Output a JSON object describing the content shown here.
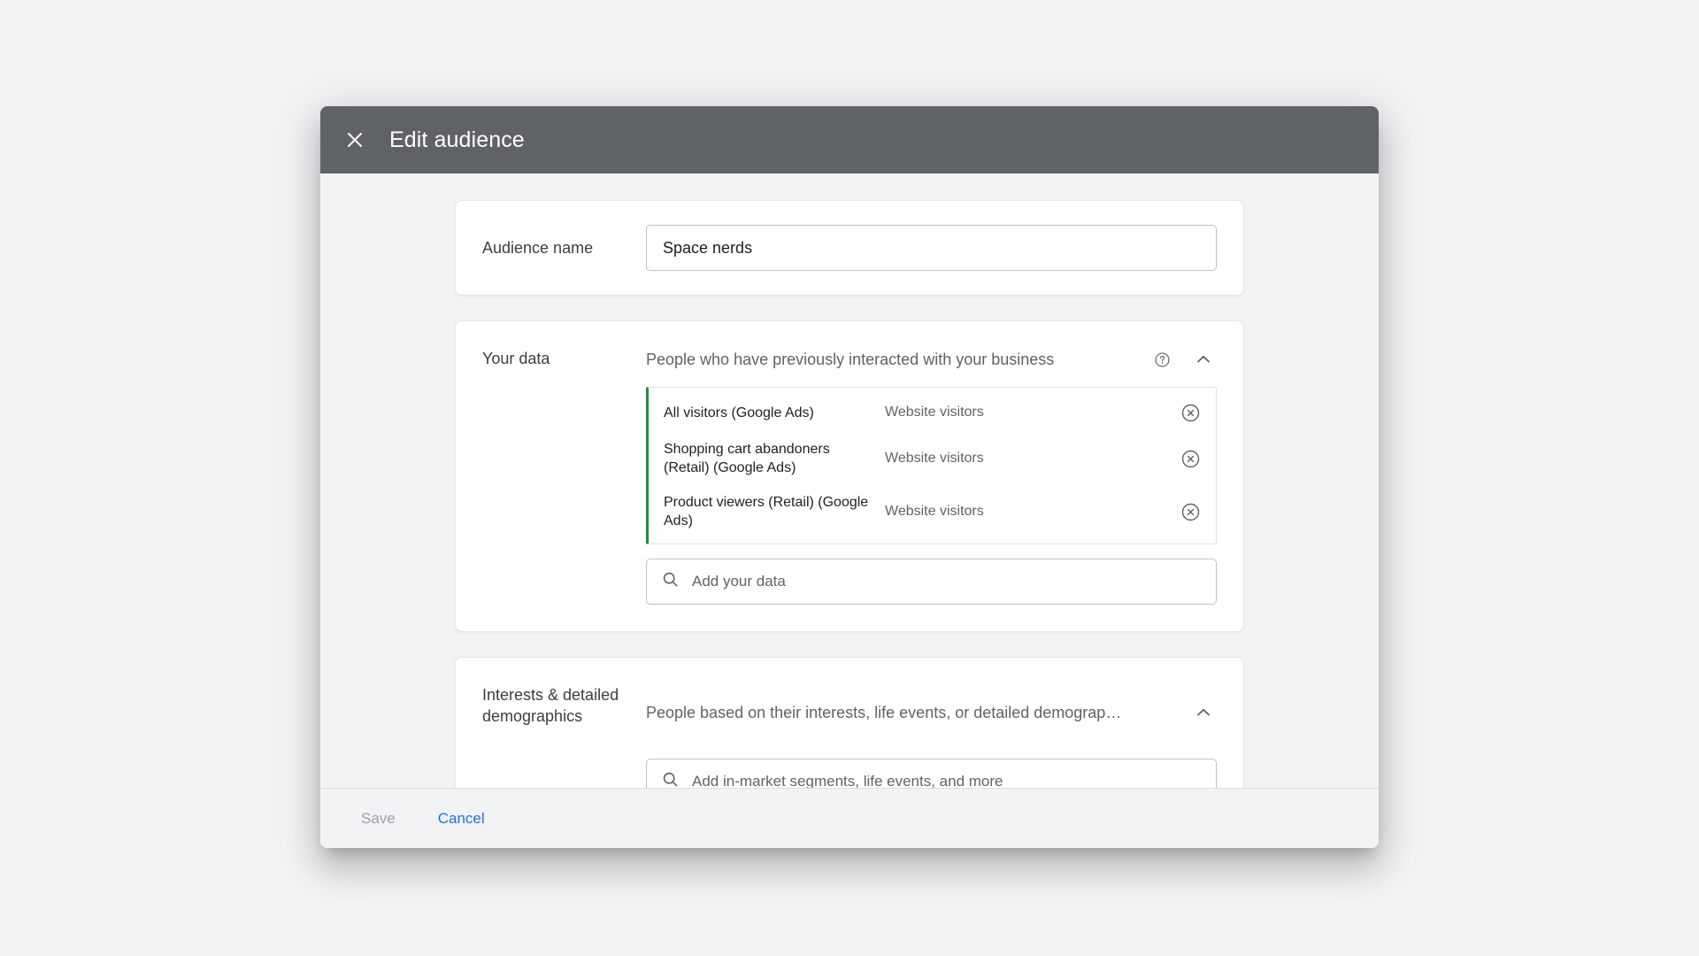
{
  "dialog": {
    "title": "Edit audience",
    "close_icon": "close-icon"
  },
  "audience_name": {
    "label": "Audience name",
    "value": "Space nerds",
    "placeholder": "Audience name"
  },
  "your_data": {
    "label": "Your data",
    "description": "People who have previously interacted with your business",
    "help_icon": "help-circle-icon",
    "collapse_icon": "chevron-up-icon",
    "items": [
      {
        "name": "All visitors (Google Ads)",
        "type": "Website visitors",
        "remove_icon": "close-circle-icon"
      },
      {
        "name": "Shopping cart abandoners (Retail) (Google Ads)",
        "type": "Website visitors",
        "remove_icon": "close-circle-icon"
      },
      {
        "name": "Product viewers (Retail) (Google Ads)",
        "type": "Website visitors",
        "remove_icon": "close-circle-icon"
      }
    ],
    "search_placeholder": "Add your data",
    "search_icon": "search-icon"
  },
  "interests": {
    "label": "Interests & detailed demographics",
    "description": "People based on their interests, life events, or detailed demograp…",
    "collapse_icon": "chevron-up-icon",
    "search_placeholder": "Add in-market segments, life events, and more",
    "search_icon": "search-icon"
  },
  "footer": {
    "save_label": "Save",
    "cancel_label": "Cancel"
  },
  "colors": {
    "header_bg": "#5f6368",
    "page_bg": "#f1f3f4",
    "accent_green": "#1e8e3e",
    "link_blue": "#1a73e8",
    "disabled_gray": "#9aa0a6",
    "text_primary": "#202124",
    "text_secondary": "#5f6368"
  }
}
